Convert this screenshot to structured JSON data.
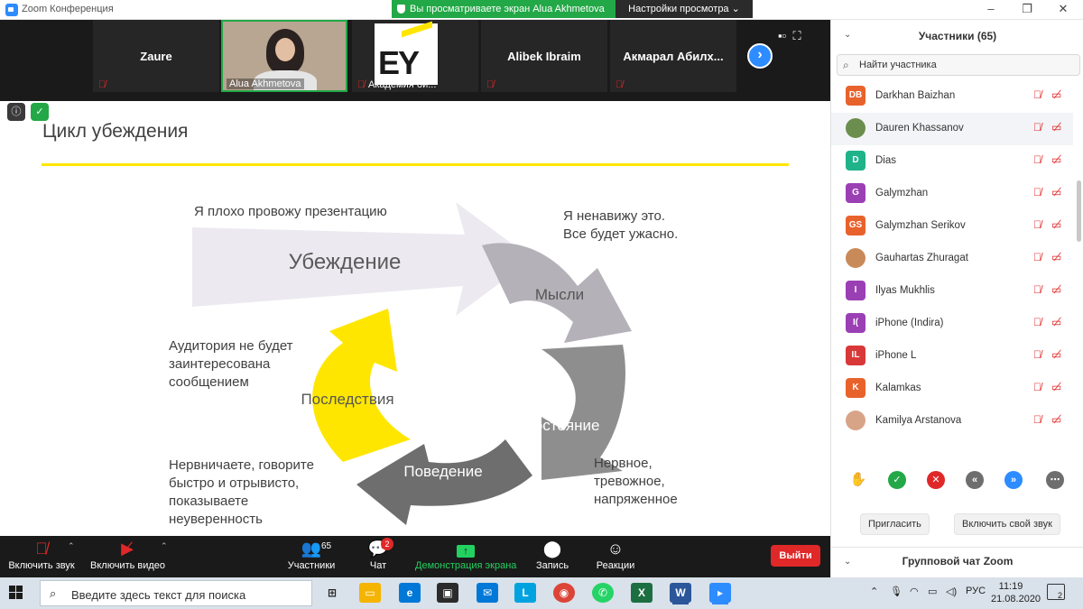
{
  "window": {
    "title": "Zoom Конференция"
  },
  "banner": {
    "viewing": "Вы просматриваете экран Alua Akhmetova",
    "view_options": "Настройки просмотра ⌄"
  },
  "video_strip": {
    "tiles": [
      {
        "name": "Zaure"
      },
      {
        "caption": "Alua Akhmetova"
      },
      {
        "caption": "Академия би..."
      },
      {
        "name": "Alibek Ibraim"
      },
      {
        "name": "Акмарал  Абилх..."
      }
    ]
  },
  "slide": {
    "title": "Цикл убеждения",
    "stages": {
      "belief": "Убеждение",
      "thoughts": "Мысли",
      "state": "Состояние",
      "behavior": "Поведение",
      "consequences": "Последствия"
    },
    "notes": {
      "top": "Я плохо провожу презентацию",
      "right_1": "Я ненавижу это.",
      "right_2": "Все будет ужасно.",
      "left_1": "Аудитория не будет",
      "left_2": "заинтересована",
      "left_3": "сообщением",
      "bottom_left_1": "Нервничаете, говорите",
      "bottom_left_2": "быстро и отрывисто,",
      "bottom_left_3": "показываете",
      "bottom_left_4": "неуверенность",
      "bottom_right_1": "Нервное,",
      "bottom_right_2": "тревожное,",
      "bottom_right_3": "напряженное"
    },
    "colors": {
      "gray_light": "#eceaf0",
      "gray_mid": "#b4b2b8",
      "gray_dark": "#8e8e8e",
      "gray_darker": "#6e6e6e",
      "yellow": "#ffe600"
    }
  },
  "toolbar": {
    "audio": "Включить звук",
    "video": "Включить видео",
    "participants": "Участники",
    "participants_count": "65",
    "chat": "Чат",
    "chat_badge": "2",
    "share": "Демонстрация экрана",
    "record": "Запись",
    "reactions": "Реакции",
    "leave": "Выйти"
  },
  "panel": {
    "title": "Участники (65)",
    "search_placeholder": "Найти участника",
    "participants": [
      {
        "initials": "DB",
        "name": "Darkhan Baizhan",
        "color": "#e8622c"
      },
      {
        "initials": "",
        "name": "Dauren Khassanov",
        "color": "#6b8e4e"
      },
      {
        "initials": "D",
        "name": "Dias",
        "color": "#1fb38a"
      },
      {
        "initials": "G",
        "name": "Galymzhan",
        "color": "#9b3fb5"
      },
      {
        "initials": "GS",
        "name": "Galymzhan Serikov",
        "color": "#e8622c"
      },
      {
        "initials": "",
        "name": "Gauhartas Zhuragat",
        "color": "#c98a5a"
      },
      {
        "initials": "I",
        "name": "Ilyas Mukhlis",
        "color": "#9b3fb5"
      },
      {
        "initials": "I(",
        "name": "iPhone (Indira)",
        "color": "#9b3fb5"
      },
      {
        "initials": "IL",
        "name": "iPhone L",
        "color": "#d93838"
      },
      {
        "initials": "K",
        "name": "Kalamkas",
        "color": "#e8622c"
      },
      {
        "initials": "",
        "name": "Kamilya Arstanova",
        "color": "#d8a488"
      }
    ],
    "invite": "Пригласить",
    "unmute_me": "Включить свой звук",
    "chat_title": "Групповой чат Zoom"
  },
  "taskbar": {
    "search_placeholder": "Введите здесь текст для поиска",
    "lang": "РУС",
    "time": "11:19",
    "date": "21.08.2020",
    "notifications": "2"
  }
}
